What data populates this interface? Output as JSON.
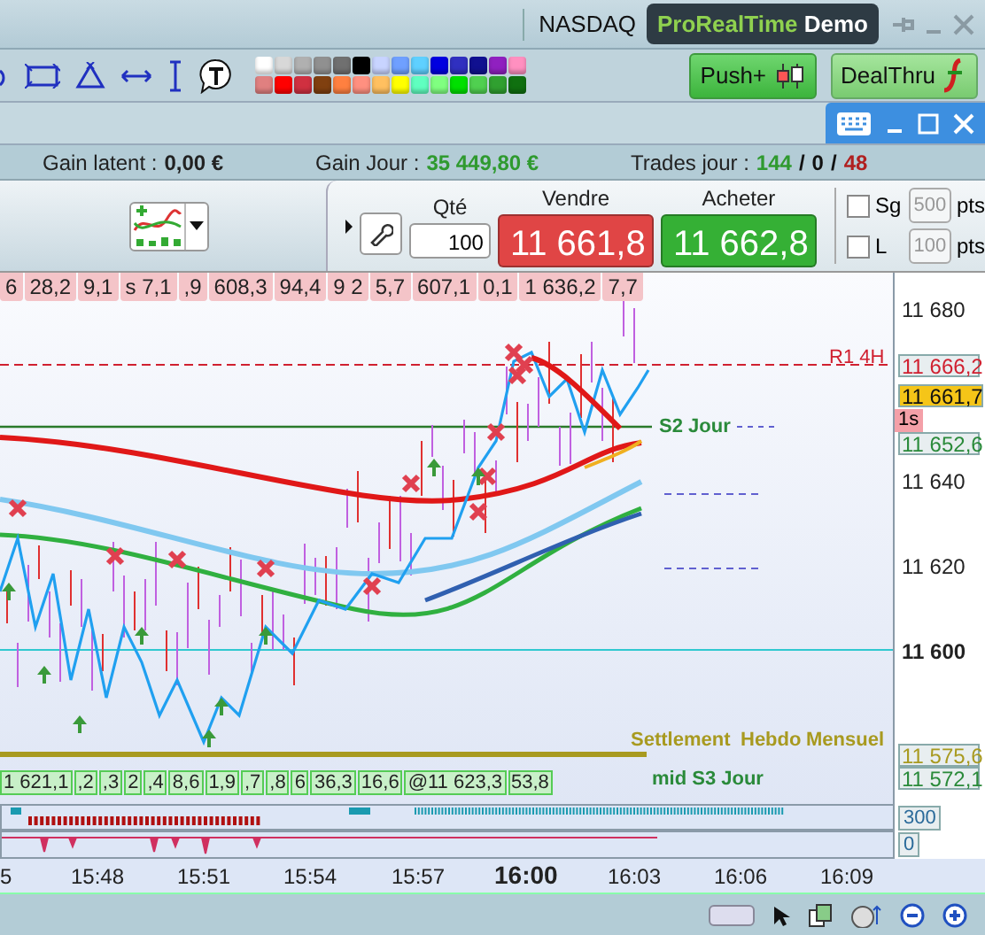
{
  "header": {
    "exchange": "NASDAQ",
    "brand": "ProRealTime",
    "edition": "Demo"
  },
  "palette": [
    [
      {
        "color": "#ffffff"
      },
      {
        "color": "#d8d8d8"
      },
      {
        "color": "#b0b0b0"
      },
      {
        "color": "#909090"
      },
      {
        "color": "#707070"
      },
      {
        "color": "#000000"
      },
      {
        "color": "#c8d4ff"
      },
      {
        "color": "#6fa0ff"
      },
      {
        "color": "#5fd0ff"
      },
      {
        "color": "#0000e0"
      },
      {
        "color": "#3030c0"
      },
      {
        "color": "#101090"
      },
      {
        "color": "#9020c0"
      },
      {
        "color": "#ff90c0"
      }
    ],
    [
      {
        "color": "#e08080"
      },
      {
        "color": "#ff0000"
      },
      {
        "color": "#d03040"
      },
      {
        "color": "#804010"
      },
      {
        "color": "#ff8040"
      },
      {
        "color": "#ff9080"
      },
      {
        "color": "#ffc060"
      },
      {
        "color": "#ffff00"
      },
      {
        "color": "#60ffc0"
      },
      {
        "color": "#80ff80"
      },
      {
        "color": "#00e000"
      },
      {
        "color": "#50d050"
      },
      {
        "color": "#30a030"
      },
      {
        "color": "#107010"
      }
    ]
  ],
  "trade_buttons": [
    "Push+",
    "DealThru"
  ],
  "info": {
    "latent_label": "Gain latent :",
    "latent": "0,00 €",
    "day_label": "Gain Jour :",
    "day": "35 449,80 €",
    "trades_label": "Trades jour :",
    "separator": "/",
    "trades": [
      {
        "text": "144",
        "kind": "win"
      },
      {
        "text": "0",
        "kind": "neutral"
      },
      {
        "text": "48",
        "kind": "loss"
      }
    ]
  },
  "order": {
    "qty_label": "Qté",
    "qty": "100",
    "sell_label": "Vendre",
    "sell": "11 661,8",
    "buy_label": "Acheter",
    "buy": "11 662,8",
    "options": [
      {
        "label": "Sg",
        "checked": false,
        "value": "500",
        "unit": "pts"
      },
      {
        "label": "L",
        "checked": false,
        "value": "100",
        "unit": "pts"
      }
    ]
  },
  "chart": {
    "top_labels": [
      "6",
      "28,2",
      "9,1",
      "s 7,1",
      ",9",
      "608,3",
      "94,4",
      "9 2",
      "5,7",
      "607,1",
      "0,1",
      "1 636,2",
      "7,7"
    ],
    "bottom_labels": [
      "1 621,1",
      ",2",
      ",3",
      "2",
      ",4",
      "8,6",
      "1,9",
      ",7",
      ",8",
      "6",
      "36,3",
      "16,6",
      "@11 623,3",
      "53,8"
    ],
    "levels": [
      {
        "text": "R1 4H",
        "kind": "resistance"
      },
      {
        "text": "S2 Jour",
        "kind": "support"
      },
      {
        "text": "Settlement",
        "kind": "settlement"
      },
      {
        "text": "Hebdo",
        "kind": "settlement"
      },
      {
        "text": "Mensuel",
        "kind": "settlement"
      },
      {
        "text": "mid S3 Jour",
        "kind": "support"
      }
    ],
    "price_ticks": [
      {
        "text": "11 680",
        "bold": false
      },
      {
        "text": "11 640",
        "bold": false
      },
      {
        "text": "11 620",
        "bold": false
      },
      {
        "text": "11 600",
        "bold": true
      }
    ],
    "price_badges": [
      {
        "text": "11 666,2",
        "kind": "resistance"
      },
      {
        "text": "11 661,7",
        "kind": "last"
      },
      {
        "text": "11 652,6",
        "kind": "support"
      },
      {
        "text": "11 575,6",
        "kind": "settlement"
      },
      {
        "text": "11 572,1",
        "kind": "support"
      }
    ],
    "timer": "1s",
    "pane_values": [
      "300",
      "0"
    ],
    "time_ticks": [
      {
        "text": "5",
        "bold": false
      },
      {
        "text": "15:48",
        "bold": false
      },
      {
        "text": "15:51",
        "bold": false
      },
      {
        "text": "15:54",
        "bold": false
      },
      {
        "text": "15:57",
        "bold": false
      },
      {
        "text": "16:00",
        "bold": true
      },
      {
        "text": "16:03",
        "bold": false
      },
      {
        "text": "16:06",
        "bold": false
      },
      {
        "text": "16:09",
        "bold": false
      }
    ]
  }
}
